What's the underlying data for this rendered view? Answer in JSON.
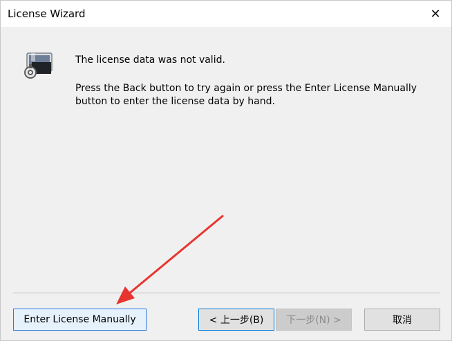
{
  "window": {
    "title": "License Wizard",
    "close_glyph": "✕"
  },
  "content": {
    "icon": "license-computer-icon",
    "message_title": "The license data was not valid.",
    "message_body": "Press the Back button to try again or press the Enter License Manually button to enter the license data by hand."
  },
  "buttons": {
    "enter_manually": "Enter License Manually",
    "back": "< 上一步(B)",
    "next": "下一步(N) >",
    "cancel": "取消"
  },
  "annotation": {
    "arrow_color": "#e8342f"
  }
}
